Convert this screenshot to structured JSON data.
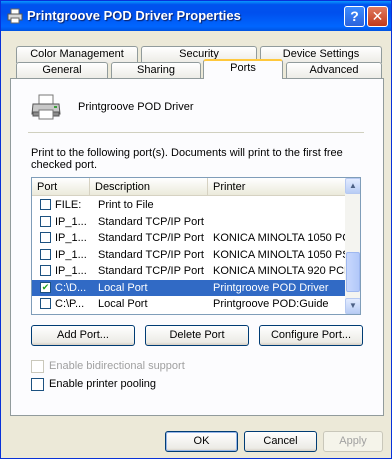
{
  "window": {
    "title": "Printgroove POD Driver Properties"
  },
  "titlebar_buttons": {
    "help": "?",
    "close": "✕"
  },
  "tabs": {
    "row1": [
      "Color Management",
      "Security",
      "Device Settings"
    ],
    "row2": [
      "General",
      "Sharing",
      "Ports",
      "Advanced"
    ],
    "active": "Ports"
  },
  "printer": {
    "name": "Printgroove POD Driver"
  },
  "instruction": "Print to the following port(s). Documents will print to the first free checked port.",
  "ports_table": {
    "columns": [
      "Port",
      "Description",
      "Printer"
    ],
    "rows": [
      {
        "checked": false,
        "selected": false,
        "port": "FILE:",
        "description": "Print to File",
        "printer": ""
      },
      {
        "checked": false,
        "selected": false,
        "port": "IP_1...",
        "description": "Standard TCP/IP Port",
        "printer": ""
      },
      {
        "checked": false,
        "selected": false,
        "port": "IP_1...",
        "description": "Standard TCP/IP Port",
        "printer": "KONICA MINOLTA 1050 PCL"
      },
      {
        "checked": false,
        "selected": false,
        "port": "IP_1...",
        "description": "Standard TCP/IP Port",
        "printer": "KONICA MINOLTA 1050 PS..."
      },
      {
        "checked": false,
        "selected": false,
        "port": "IP_1...",
        "description": "Standard TCP/IP Port",
        "printer": "KONICA MINOLTA 920 PCL"
      },
      {
        "checked": true,
        "selected": true,
        "port": "C:\\D...",
        "description": "Local Port",
        "printer": "Printgroove POD Driver"
      },
      {
        "checked": false,
        "selected": false,
        "port": "C:\\P...",
        "description": "Local Port",
        "printer": "Printgroove POD:Guide"
      }
    ]
  },
  "port_buttons": {
    "add": "Add Port...",
    "delete": "Delete Port",
    "configure": "Configure Port..."
  },
  "options": {
    "bidirectional": {
      "label": "Enable bidirectional support",
      "checked": false,
      "enabled": false
    },
    "pooling": {
      "label": "Enable printer pooling",
      "checked": false,
      "enabled": true
    }
  },
  "dialog_buttons": {
    "ok": "OK",
    "cancel": "Cancel",
    "apply": "Apply"
  },
  "colors": {
    "titlebar": "#0053ee",
    "selection": "#316ac5",
    "tab_highlight": "#ffc83c"
  }
}
